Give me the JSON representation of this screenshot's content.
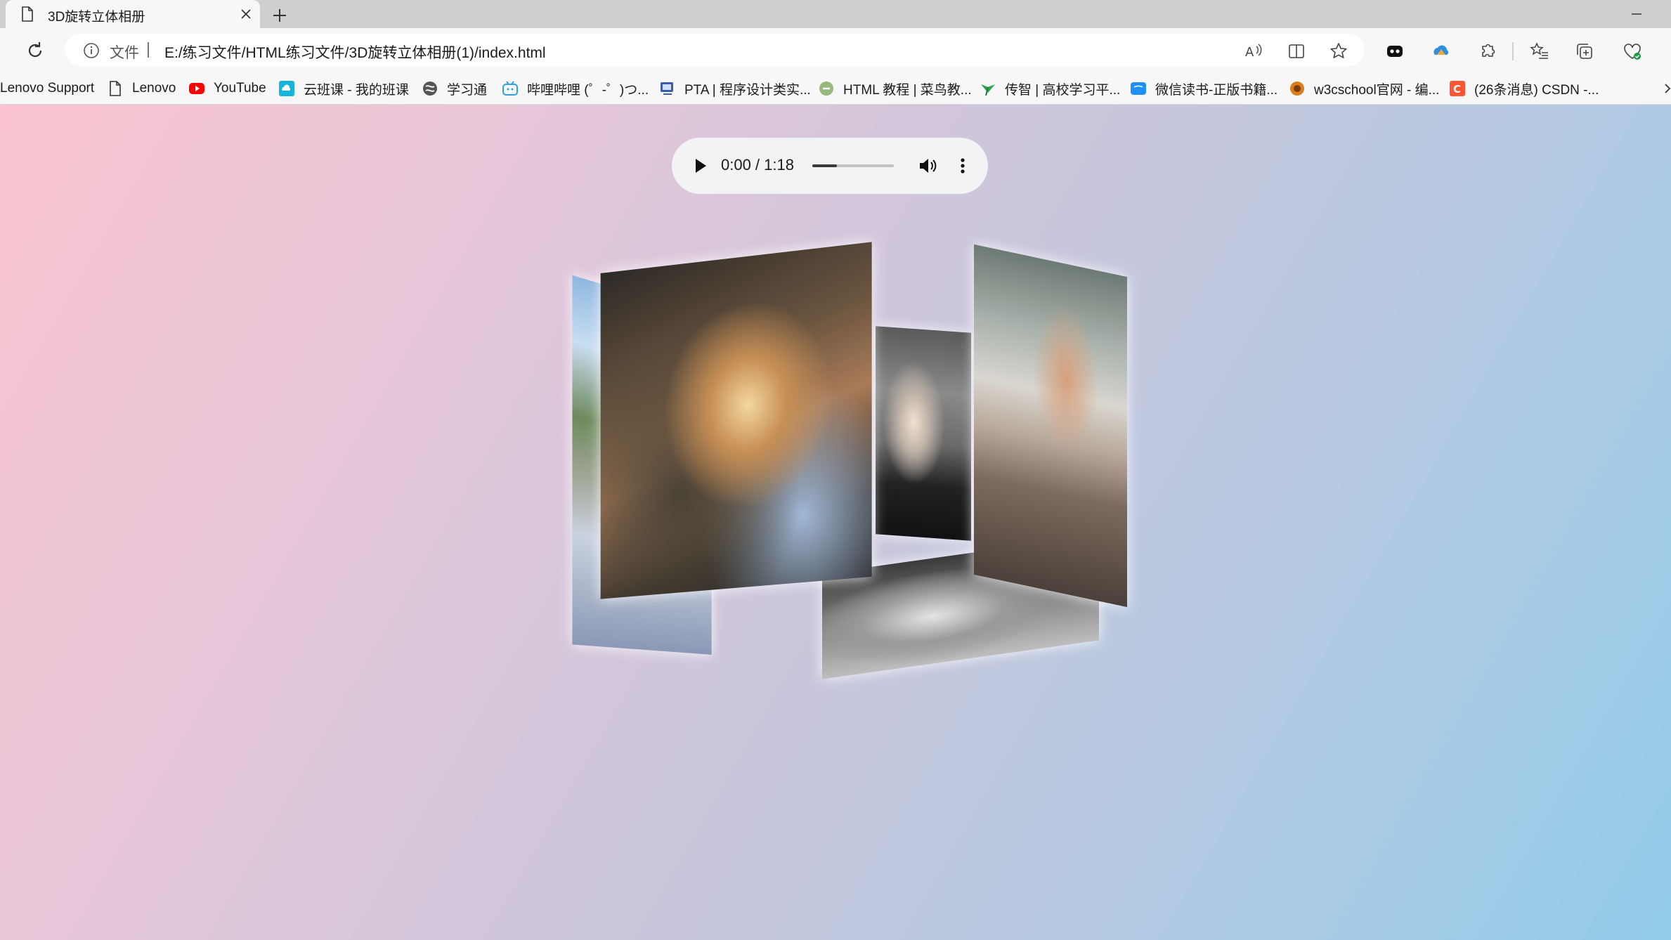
{
  "browser": {
    "tab": {
      "title": "3D旋转立体相册"
    },
    "address": {
      "scheme_label": "文件",
      "url": "E:/练习文件/HTML练习文件/3D旋转立体相册(1)/index.html"
    },
    "bookmarks": [
      {
        "label": "Lenovo Support",
        "icon": "none"
      },
      {
        "label": "Lenovo",
        "icon": "page-icon"
      },
      {
        "label": "YouTube",
        "icon": "youtube-icon"
      },
      {
        "label": "云班课 - 我的班课",
        "icon": "cloud-class-icon"
      },
      {
        "label": "学习通",
        "icon": "xuexitong-icon"
      },
      {
        "label": "哔哩哔哩 (゜-゜)つ...",
        "icon": "bilibili-icon"
      },
      {
        "label": "PTA | 程序设计类实...",
        "icon": "pta-icon"
      },
      {
        "label": "HTML 教程 | 菜鸟教...",
        "icon": "runoob-icon"
      },
      {
        "label": "传智 | 高校学习平...",
        "icon": "chuanzhi-icon"
      },
      {
        "label": "微信读书-正版书籍...",
        "icon": "weread-icon"
      },
      {
        "label": "w3cschool官网 - 编...",
        "icon": "w3cschool-icon"
      },
      {
        "label": "(26条消息) CSDN -...",
        "icon": "csdn-icon"
      }
    ]
  },
  "page": {
    "audio": {
      "time": "0:00 / 1:18",
      "progress": 0.3
    },
    "photos": [
      {
        "name": "photo-left",
        "subject": "blue sky and trees"
      },
      {
        "name": "photo-front",
        "subject": "friends toasting glasses"
      },
      {
        "name": "photo-mid",
        "subject": "silhouette at sunset"
      },
      {
        "name": "photo-right",
        "subject": "restaurant table scene"
      },
      {
        "name": "photo-bottom",
        "subject": "monochrome selfie"
      }
    ]
  },
  "colors": {
    "bg_start": "#f9c3cf",
    "bg_end": "#91cbe9",
    "youtube": "#ff0000",
    "csdn": "#fc5531",
    "cloud_class": "#18b4e0",
    "bilibili": "#2fa0e6"
  }
}
